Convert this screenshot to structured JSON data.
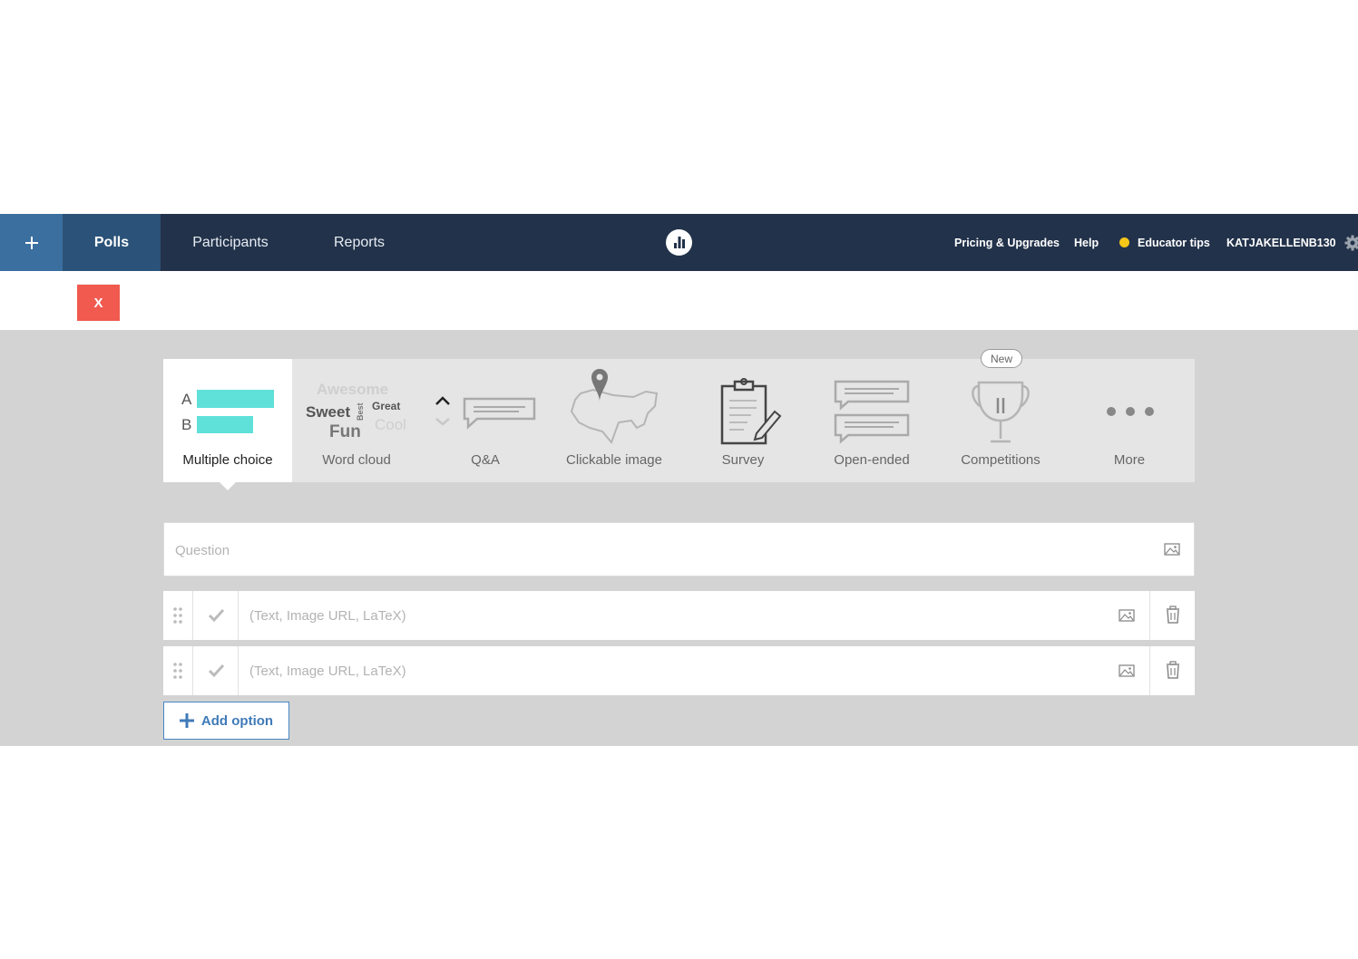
{
  "nav": {
    "tabs": [
      {
        "label": "Polls"
      },
      {
        "label": "Participants"
      },
      {
        "label": "Reports"
      }
    ],
    "pricing": "Pricing & Upgrades",
    "help": "Help",
    "educator_tips": "Educator tips",
    "username": "KATJAKELLENB130"
  },
  "close_label": "X",
  "types": {
    "multiple_choice": {
      "label": "Multiple choice",
      "a": "A",
      "b": "B"
    },
    "word_cloud": {
      "label": "Word cloud",
      "words": [
        "Awesome",
        "Sweet",
        "Best",
        "Great",
        "Fun",
        "Cool"
      ]
    },
    "qa": {
      "label": "Q&A"
    },
    "clickable_image": {
      "label": "Clickable image"
    },
    "survey": {
      "label": "Survey"
    },
    "open_ended": {
      "label": "Open-ended"
    },
    "competitions": {
      "label": "Competitions",
      "badge": "New"
    },
    "more": {
      "label": "More"
    }
  },
  "question": {
    "placeholder": "Question",
    "value": ""
  },
  "options": [
    {
      "placeholder": "(Text, Image URL, LaTeX)",
      "value": ""
    },
    {
      "placeholder": "(Text, Image URL, LaTeX)",
      "value": ""
    }
  ],
  "add_option_label": "Add option",
  "colors": {
    "navbar": "#22324a",
    "active_tab": "#2b5278",
    "add_tab": "#3b6fa0",
    "close": "#f05a4f",
    "accent_cyan": "#5fe0d9",
    "link": "#3f7ab8",
    "tips_dot": "#f5c518"
  }
}
